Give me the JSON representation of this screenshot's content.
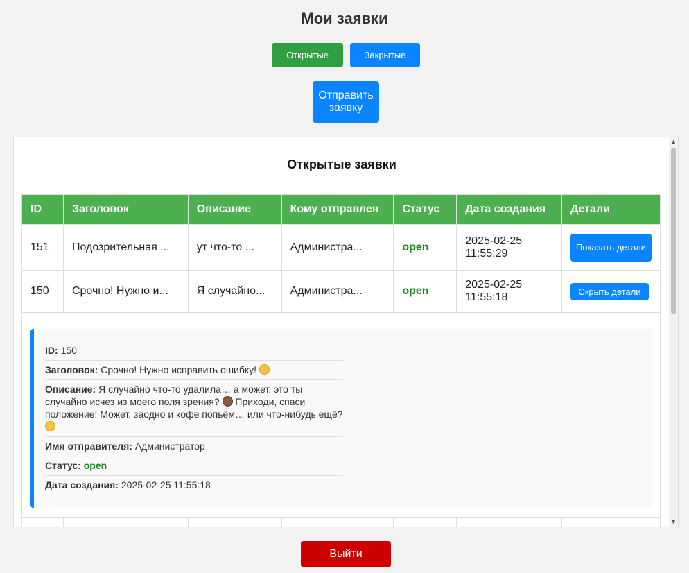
{
  "header": {
    "title": "Мои заявки"
  },
  "tabs": {
    "open_label": "Открытые",
    "closed_label": "Закрытые"
  },
  "send_button": "Отправить заявку",
  "section_title": "Открытые заявки",
  "table": {
    "columns": [
      "ID",
      "Заголовок",
      "Описание",
      "Кому отправлен",
      "Статус",
      "Дата создания",
      "Детали"
    ],
    "rows": [
      {
        "id": "151",
        "title": "Подозрительная ...",
        "description": "ут что-то ...",
        "recipient": "Администра...",
        "status": "open",
        "date_line1": "2025-02-25",
        "date_line2": "11:55:29",
        "button": "Показать детали"
      },
      {
        "id": "150",
        "title": "Срочно! Нужно и...",
        "description": "Я случайно...",
        "recipient": "Администра...",
        "status": "open",
        "date_line1": "2025-02-25",
        "date_line2": "11:55:18",
        "button": "Скрыть детали"
      }
    ]
  },
  "details": {
    "id_label": "ID:",
    "id_value": "150",
    "title_label": "Заголовок:",
    "title_value": "Срочно! Нужно исправить ошибку!",
    "desc_label": "Описание:",
    "desc_part1": "Я случайно что-то удалила… а может, это ты случайно исчез из моего поля зрения?",
    "desc_part2": "Приходи, спаси положение! Может, заодно и кофе попьём… или что-нибудь ещё?",
    "sender_label": "Имя отправителя:",
    "sender_value": "Администратор",
    "status_label": "Статус:",
    "status_value": "open",
    "date_label": "Дата создания:",
    "date_value": "2025-02-25 11:55:18",
    "emoji_icons": [
      "smirk-emoji-icon",
      "see-no-evil-monkey-icon",
      "winking-tongue-emoji-icon"
    ]
  },
  "logout_button": "Выйти",
  "colors": {
    "green": "#2ea043",
    "blue": "#0a84ff",
    "red": "#cc0000",
    "table_header": "#4caf50"
  }
}
